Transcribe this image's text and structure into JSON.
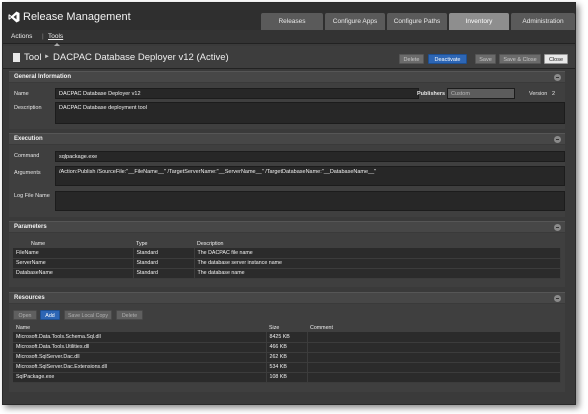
{
  "app": {
    "title": "Release Management"
  },
  "tabs": [
    "Releases",
    "Configure Apps",
    "Configure Paths",
    "Inventory",
    "Administration"
  ],
  "subnav": {
    "actions": "Actions",
    "separator": "|",
    "tools": "Tools"
  },
  "header": {
    "breadcrumb_root": "Tool",
    "breadcrumb_arrow": "►",
    "item_name": "DACPAC Database Deployer v12 (Active)",
    "buttons": {
      "delete": "Delete",
      "deactivate": "Deactivate",
      "save": "Save",
      "save_close": "Save & Close",
      "close": "Close"
    }
  },
  "general": {
    "section_title": "General Information",
    "name_label": "Name",
    "name_value": "DACPAC Database Deployer v12",
    "publishers_label": "Publishers",
    "publishers_value": "Custom",
    "version_label": "Version",
    "version_value": "2",
    "description_label": "Description",
    "description_value": "DACPAC Database deployment tool"
  },
  "execution": {
    "section_title": "Execution",
    "command_label": "Command",
    "command_value": "sqlpackage.exe",
    "arguments_label": "Arguments",
    "arguments_value": "/Action:Publish /SourceFile:\"__FileName__\" /TargetServerName:\"__ServerName__\" /TargetDatabaseName:\"__DatabaseName__\"",
    "logfile_label": "Log File Name",
    "logfile_value": ""
  },
  "parameters": {
    "section_title": "Parameters",
    "columns": [
      "Name",
      "Type",
      "Description"
    ],
    "rows": [
      [
        "FileName",
        "Standard",
        "The DACPAC file name"
      ],
      [
        "ServerName",
        "Standard",
        "The database server instance name"
      ],
      [
        "DatabaseName",
        "Standard",
        "The database name"
      ]
    ]
  },
  "resources": {
    "section_title": "Resources",
    "buttons": {
      "open": "Open",
      "add": "Add",
      "save_local_copy": "Save Local Copy",
      "delete": "Delete"
    },
    "columns": [
      "Name",
      "Size",
      "Comment"
    ],
    "rows": [
      [
        "Microsoft.Data.Tools.Schema.Sql.dll",
        "8425 KB",
        ""
      ],
      [
        "Microsoft.Data.Tools.Utilities.dll",
        "466 KB",
        ""
      ],
      [
        "Microsoft.SqlServer.Dac.dll",
        "262 KB",
        ""
      ],
      [
        "Microsoft.SqlServer.Dac.Extensions.dll",
        "534 KB",
        ""
      ],
      [
        "SqlPackage.exe",
        "108 KB",
        ""
      ]
    ]
  }
}
